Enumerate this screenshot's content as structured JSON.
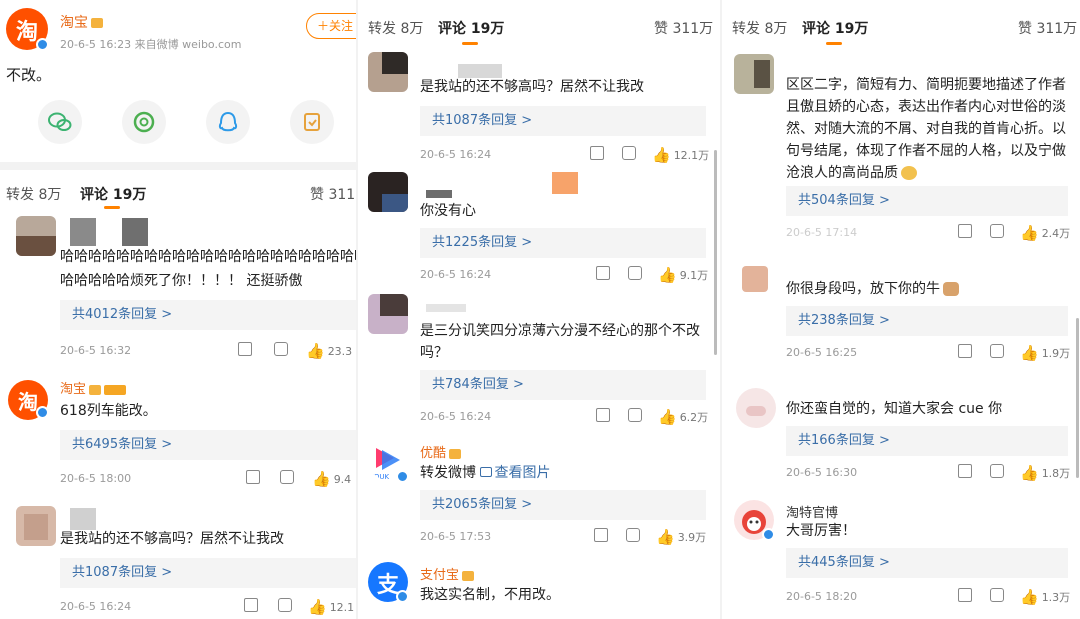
{
  "post": {
    "author": "淘宝",
    "time_source": "20-6-5 16:23 来自微博 weibo.com",
    "follow_label": "＋关注",
    "body": "不改。",
    "share_icons": [
      "wechat-icon",
      "moments-icon",
      "qq-icon",
      "save-icon"
    ]
  },
  "tabs": {
    "repost": "转发",
    "repost_count_a": "8万",
    "repost_count_b": "8万",
    "repost_count_c": "8万",
    "comments": "评论",
    "comments_count": "19万",
    "likes": "赞",
    "likes_count_a": "311万",
    "likes_count_b": "311万",
    "likes_count_c": "311万",
    "likes_count_clipped": "311"
  },
  "panel1_comments": [
    {
      "text1": "哈哈哈哈哈哈哈哈哈哈哈哈哈哈哈哈哈哈哈哈哈哈哈",
      "text2": "哈哈哈哈哈烦死了你！！！！ 还挺骄傲",
      "replies": "共4012条回复 >",
      "time": "20-6-5 16:32",
      "likes": "23.3"
    },
    {
      "user": "淘宝",
      "text1": "618列车能改。",
      "replies": "共6495条回复 >",
      "time": "20-6-5 18:00",
      "likes": "9.4"
    },
    {
      "text1": "是我站的还不够高吗？居然不让我改",
      "replies": "共1087条回复 >",
      "time": "20-6-5 16:24",
      "likes": "12.1"
    }
  ],
  "panel2_comments": [
    {
      "text1": "是我站的还不够高吗？居然不让我改",
      "replies": "共1087条回复 >",
      "time": "20-6-5 16:24",
      "likes": "12.1万"
    },
    {
      "text1": "你没有心",
      "replies": "共1225条回复 >",
      "time": "20-6-5 16:24",
      "likes": "9.1万"
    },
    {
      "text1": "是三分讥笑四分凉薄六分漫不经心的那个不改",
      "text2": "吗？",
      "replies": "共784条回复 >",
      "time": "20-6-5 16:24",
      "likes": "6.2万"
    },
    {
      "user": "优酷",
      "text1": "转发微博",
      "pics": "查看图片",
      "replies": "共2065条回复 >",
      "time": "20-6-5 17:53",
      "likes": "3.9万"
    },
    {
      "user": "支付宝",
      "text1": "我这实名制，不用改。"
    }
  ],
  "panel3_comments": [
    {
      "text1": "区区二字，简短有力、简明扼要地描述了作者",
      "text2": "且傲且娇的心态，表达出作者内心对世俗的淡",
      "text3": "然、对随大流的不屑、对自我的首肯心折。以",
      "text4": "句号结尾，体现了作者不屈的人格，以及宁做",
      "text5": "沧浪人的高尚品质",
      "replies": "共504条回复 >",
      "time": "20-6-5 17:14",
      "likes": "2.4万"
    },
    {
      "text1": "你很身段吗，放下你的牛",
      "replies": "共238条回复 >",
      "time": "20-6-5 16:25",
      "likes": "1.9万"
    },
    {
      "text1": "你还蛮自觉的，知道大家会 cue 你",
      "replies": "共166条回复 >",
      "time": "20-6-5 16:30",
      "likes": "1.8万"
    },
    {
      "user": "淘特官博",
      "text1": "大哥厉害！",
      "replies": "共445条回复 >",
      "time": "20-6-5 18:20",
      "likes": "1.3万"
    }
  ],
  "colors": {
    "taobao_orange": "#ff5000",
    "link_blue": "#3a6ea8",
    "tab_underline": "#ff8200",
    "username_orange": "#e86b1a"
  }
}
